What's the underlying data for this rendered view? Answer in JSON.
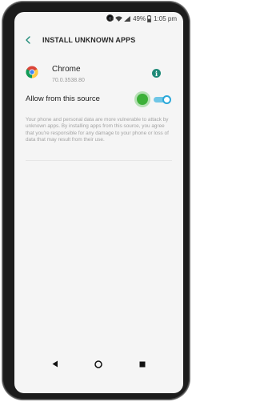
{
  "status_bar": {
    "battery": "49%",
    "time": "1:05 pm",
    "icons": [
      "mute-icon",
      "wifi-icon",
      "signal-icon",
      "battery-icon"
    ]
  },
  "app_bar": {
    "back_icon": "chevron-left-icon",
    "title": "INSTALL UNKNOWN APPS"
  },
  "app": {
    "name": "Chrome",
    "version": "70.0.3538.80",
    "icon": "chrome-icon",
    "info_icon": "info-icon",
    "info_glyph": "i"
  },
  "setting": {
    "label": "Allow from this source",
    "enabled": true
  },
  "warning_text": "Your phone and personal data are more vulnerable to attack by unknown apps. By installing apps from this source, you agree that you're responsible for any damage to your phone or loss of data that may result from their use.",
  "navigation": {
    "back": "back-triangle-icon",
    "home": "home-circle-icon",
    "recents": "recents-square-icon"
  },
  "colors": {
    "accent_teal": "#1f8a78",
    "toggle_on": "#2ba8d9",
    "touch_indicator": "#3cb038"
  }
}
